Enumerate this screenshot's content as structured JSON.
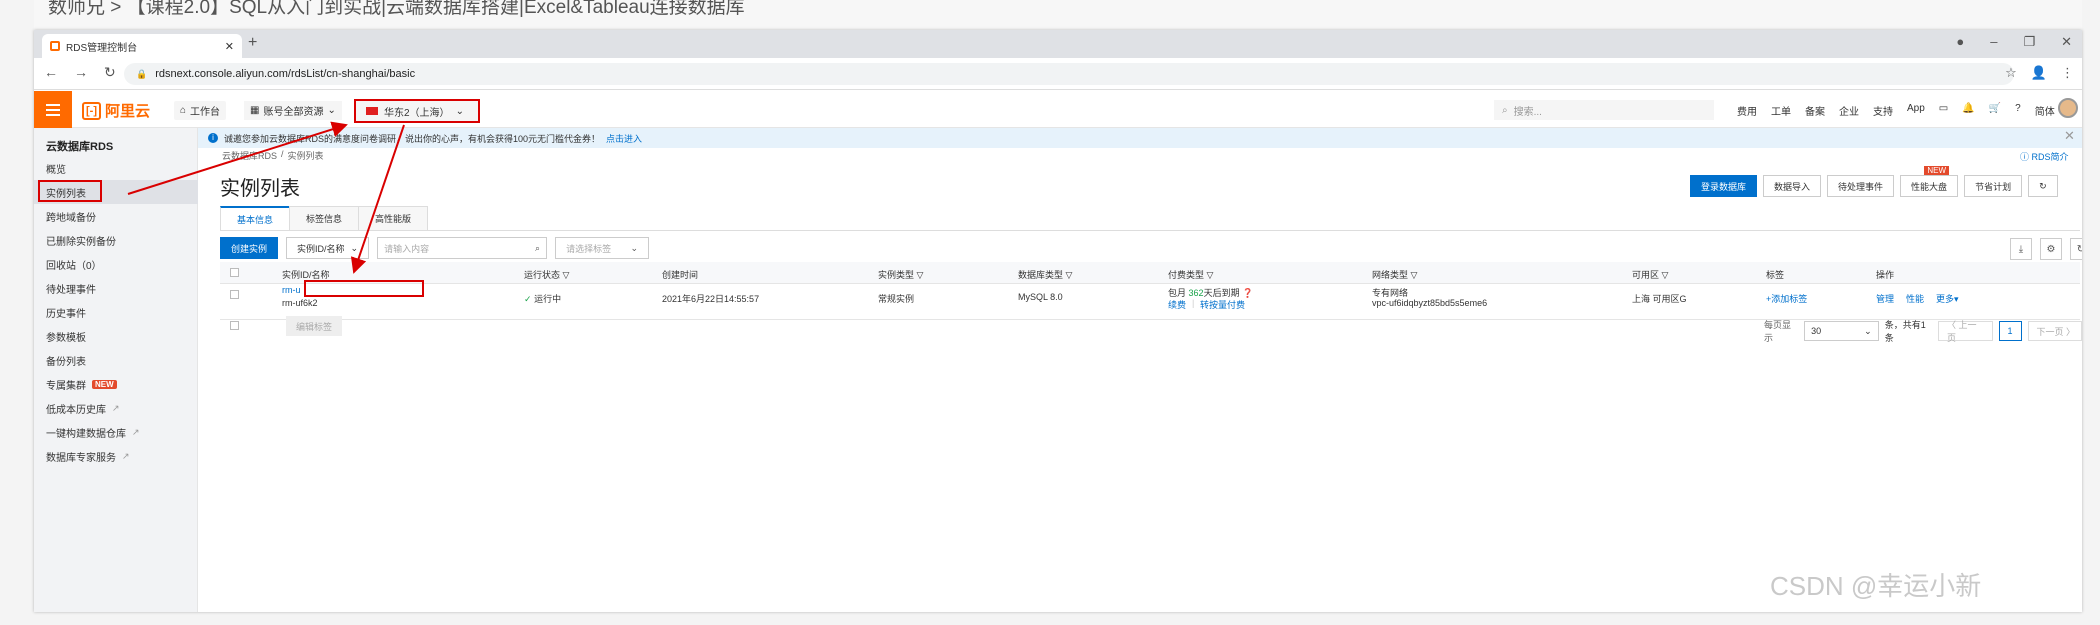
{
  "background": {
    "title": "数师兄  >  【课程2.0】SQL从入门到实战|云端数据库搭建|Excel&Tableau连接数据库"
  },
  "browser": {
    "tab_title": "RDS管理控制台",
    "url": "rdsnext.console.aliyun.com/rdsList/cn-shanghai/basic"
  },
  "header": {
    "logo": "阿里云",
    "workbench": "工作台",
    "account": "账号全部资源",
    "region": "华东2（上海）",
    "search_placeholder": "搜索...",
    "links": [
      "费用",
      "工单",
      "备案",
      "企业",
      "支持",
      "App"
    ],
    "lang": "简体"
  },
  "sidebar": {
    "title": "云数据库RDS",
    "items": [
      {
        "label": "概览"
      },
      {
        "label": "实例列表"
      },
      {
        "label": "跨地域备份"
      },
      {
        "label": "已删除实例备份"
      },
      {
        "label": "回收站（0）"
      },
      {
        "label": "待处理事件"
      },
      {
        "label": "历史事件"
      },
      {
        "label": "参数模板"
      },
      {
        "label": "备份列表"
      },
      {
        "label": "专属集群",
        "badge": "NEW"
      },
      {
        "label": "低成本历史库"
      },
      {
        "label": "一键构建数据仓库"
      },
      {
        "label": "数据库专家服务"
      }
    ]
  },
  "notice": {
    "text": "诚邀您参加云数据库RDS的满意度问卷调研，说出你的心声，有机会获得100元无门槛代金券！",
    "link": "点击进入"
  },
  "breadcrumb": [
    "云数据库RDS",
    "/",
    "实例列表"
  ],
  "rds_intro": "RDS简介",
  "page_title": "实例列表",
  "actions": {
    "login": "登录数据库",
    "import": "数据导入",
    "events": "待处理事件",
    "perf": "性能大盘",
    "perf_badge": "NEW",
    "savings": "节省计划"
  },
  "tabs": [
    "基本信息",
    "标签信息",
    "高性能版"
  ],
  "filter": {
    "create": "创建实例",
    "field": "实例ID/名称",
    "placeholder": "请输入内容",
    "tag_placeholder": "请选择标签"
  },
  "table": {
    "headers": [
      "实例ID/名称",
      "运行状态",
      "创建时间",
      "实例类型",
      "数据库类型",
      "付费类型",
      "网络类型",
      "可用区",
      "标签",
      "操作"
    ],
    "row": {
      "id": "rm-u",
      "name": "rm-uf6k2",
      "status": "运行中",
      "created": "2021年6月22日14:55:57",
      "type": "常规实例",
      "db": "MySQL 8.0",
      "pay_prefix": "包月",
      "pay_days": "362",
      "pay_suffix": "天后到期",
      "renew": "续费",
      "convert": "转按量付费",
      "net": "专有网络",
      "vpc": "vpc-uf6idqbyzt85bd5s5eme6",
      "zone": "上海 可用区G",
      "tag": "+添加标签",
      "ops": [
        "管理",
        "性能",
        "更多"
      ]
    }
  },
  "footer": {
    "edit_tag": "编辑标签",
    "per_page_label": "每页显示",
    "per_page": "30",
    "total": "条，共有1条",
    "prev": "〈 上一页",
    "page": "1",
    "next": "下一页 〉"
  },
  "watermark": "CSDN @幸运小新"
}
